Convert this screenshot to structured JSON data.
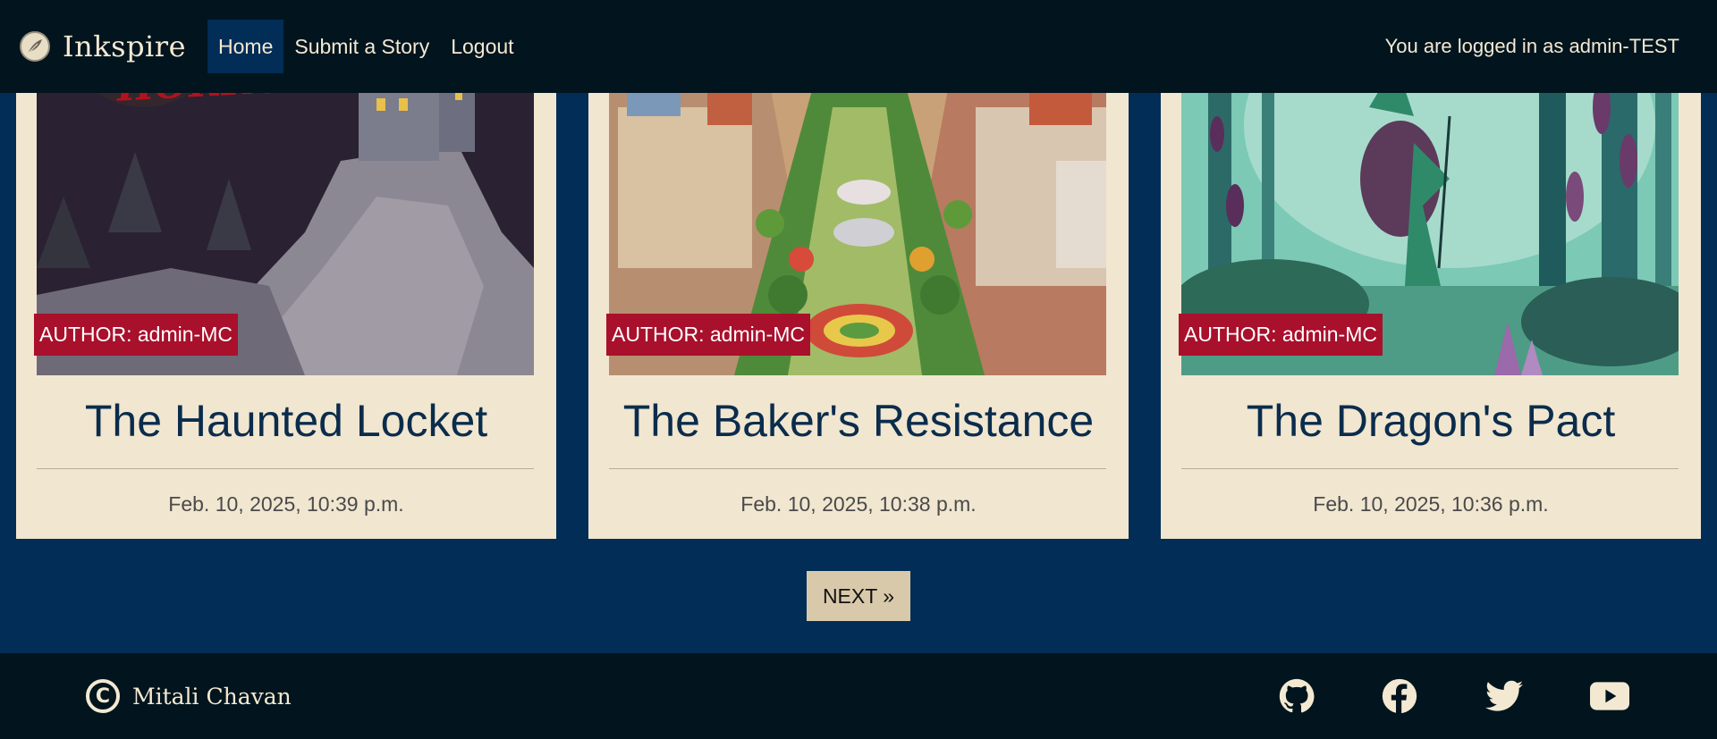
{
  "navbar": {
    "brand": "Inkspire",
    "links": [
      {
        "label": "Home",
        "active": true
      },
      {
        "label": "Submit a Story",
        "active": false
      },
      {
        "label": "Logout",
        "active": false
      }
    ],
    "user_status": "You are logged in as admin-TEST"
  },
  "stories": [
    {
      "author": "AUTHOR: admin-MC",
      "title": "The Haunted Locket",
      "date": "Feb. 10, 2025, 10:39 p.m.",
      "image_text": "HORROR"
    },
    {
      "author": "AUTHOR: admin-MC",
      "title": "The Baker's Resistance",
      "date": "Feb. 10, 2025, 10:38 p.m."
    },
    {
      "author": "AUTHOR: admin-MC",
      "title": "The Dragon's Pact",
      "date": "Feb. 10, 2025, 10:36 p.m."
    }
  ],
  "pagination": {
    "next_label": "NEXT »"
  },
  "footer": {
    "copyright_name": "Mitali Chavan",
    "social_icons": [
      "github-icon",
      "facebook-icon",
      "twitter-icon",
      "youtube-icon"
    ]
  },
  "colors": {
    "page_background": "#022d56",
    "navbar_background": "#02141e",
    "card_background": "#f1e6d0",
    "author_badge": "#a8102c",
    "title_text": "#0b2c4c",
    "next_button": "#d9c9ab"
  }
}
